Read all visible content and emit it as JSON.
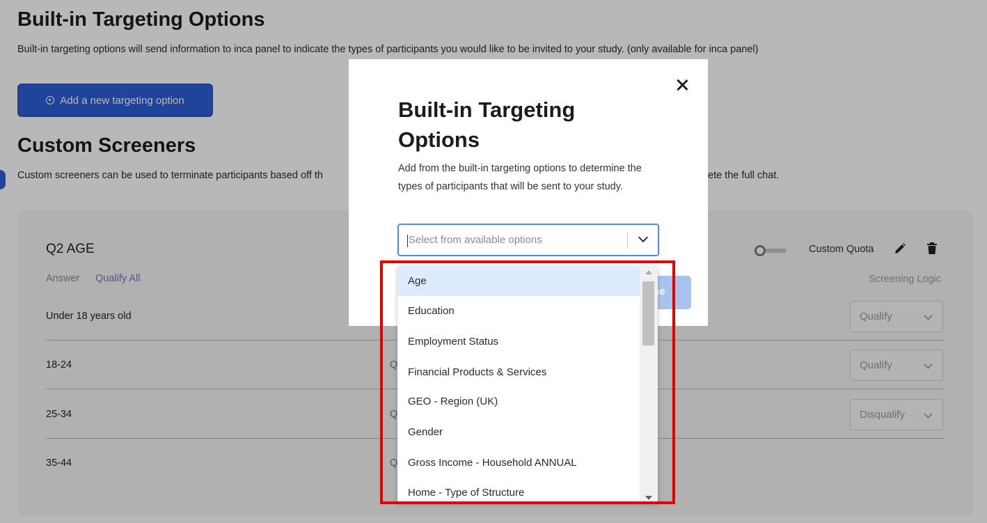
{
  "page": {
    "title": "Built-in Targeting Options",
    "description": "Built-in targeting options will send information to inca panel to indicate the types of participants you would like to be invited to your study. (only available for inca panel)",
    "add_button": "Add a new targeting option",
    "custom_title": "Custom Screeners",
    "custom_desc_left": "Custom screeners can be used to terminate participants based off th",
    "custom_desc_right": "ete the full chat."
  },
  "question": {
    "title": "Q2 AGE",
    "answer_label": "Answer",
    "qualify_all": "Qualify All",
    "custom_quota": "Custom Quota",
    "screening_logic": "Screening Logic",
    "rows": [
      {
        "label": "Under 18 years old",
        "logic": "Qualify",
        "stub": ""
      },
      {
        "label": "18-24",
        "logic": "Qualify",
        "stub": "Q"
      },
      {
        "label": "25-34",
        "logic": "Disqualify",
        "stub": "Q"
      },
      {
        "label": "35-44",
        "logic": "",
        "stub": "Q"
      }
    ]
  },
  "modal": {
    "title": "Built-in Targeting Options",
    "description": "Add from the built-in targeting options to determine the types of participants that will be sent to your study.",
    "select_placeholder": "Select from available options",
    "done_partial": "ne",
    "options": [
      "Age",
      "Education",
      "Employment Status",
      "Financial Products & Services",
      "GEO - Region (UK)",
      "Gender",
      "Gross Income - Household ANNUAL",
      "Home - Type of Structure"
    ],
    "highlighted_option": "Age"
  },
  "colors": {
    "primary": "#2d5fd6",
    "highlight_border": "#e60000",
    "option_active": "#deebff",
    "focus_border": "#4a8df0"
  },
  "icons": {
    "add": "target-icon",
    "close": "close-icon",
    "edit": "pencil-icon",
    "delete": "trash-icon",
    "toggle": "toggle-switch",
    "chevron": "chevron-down-icon"
  }
}
